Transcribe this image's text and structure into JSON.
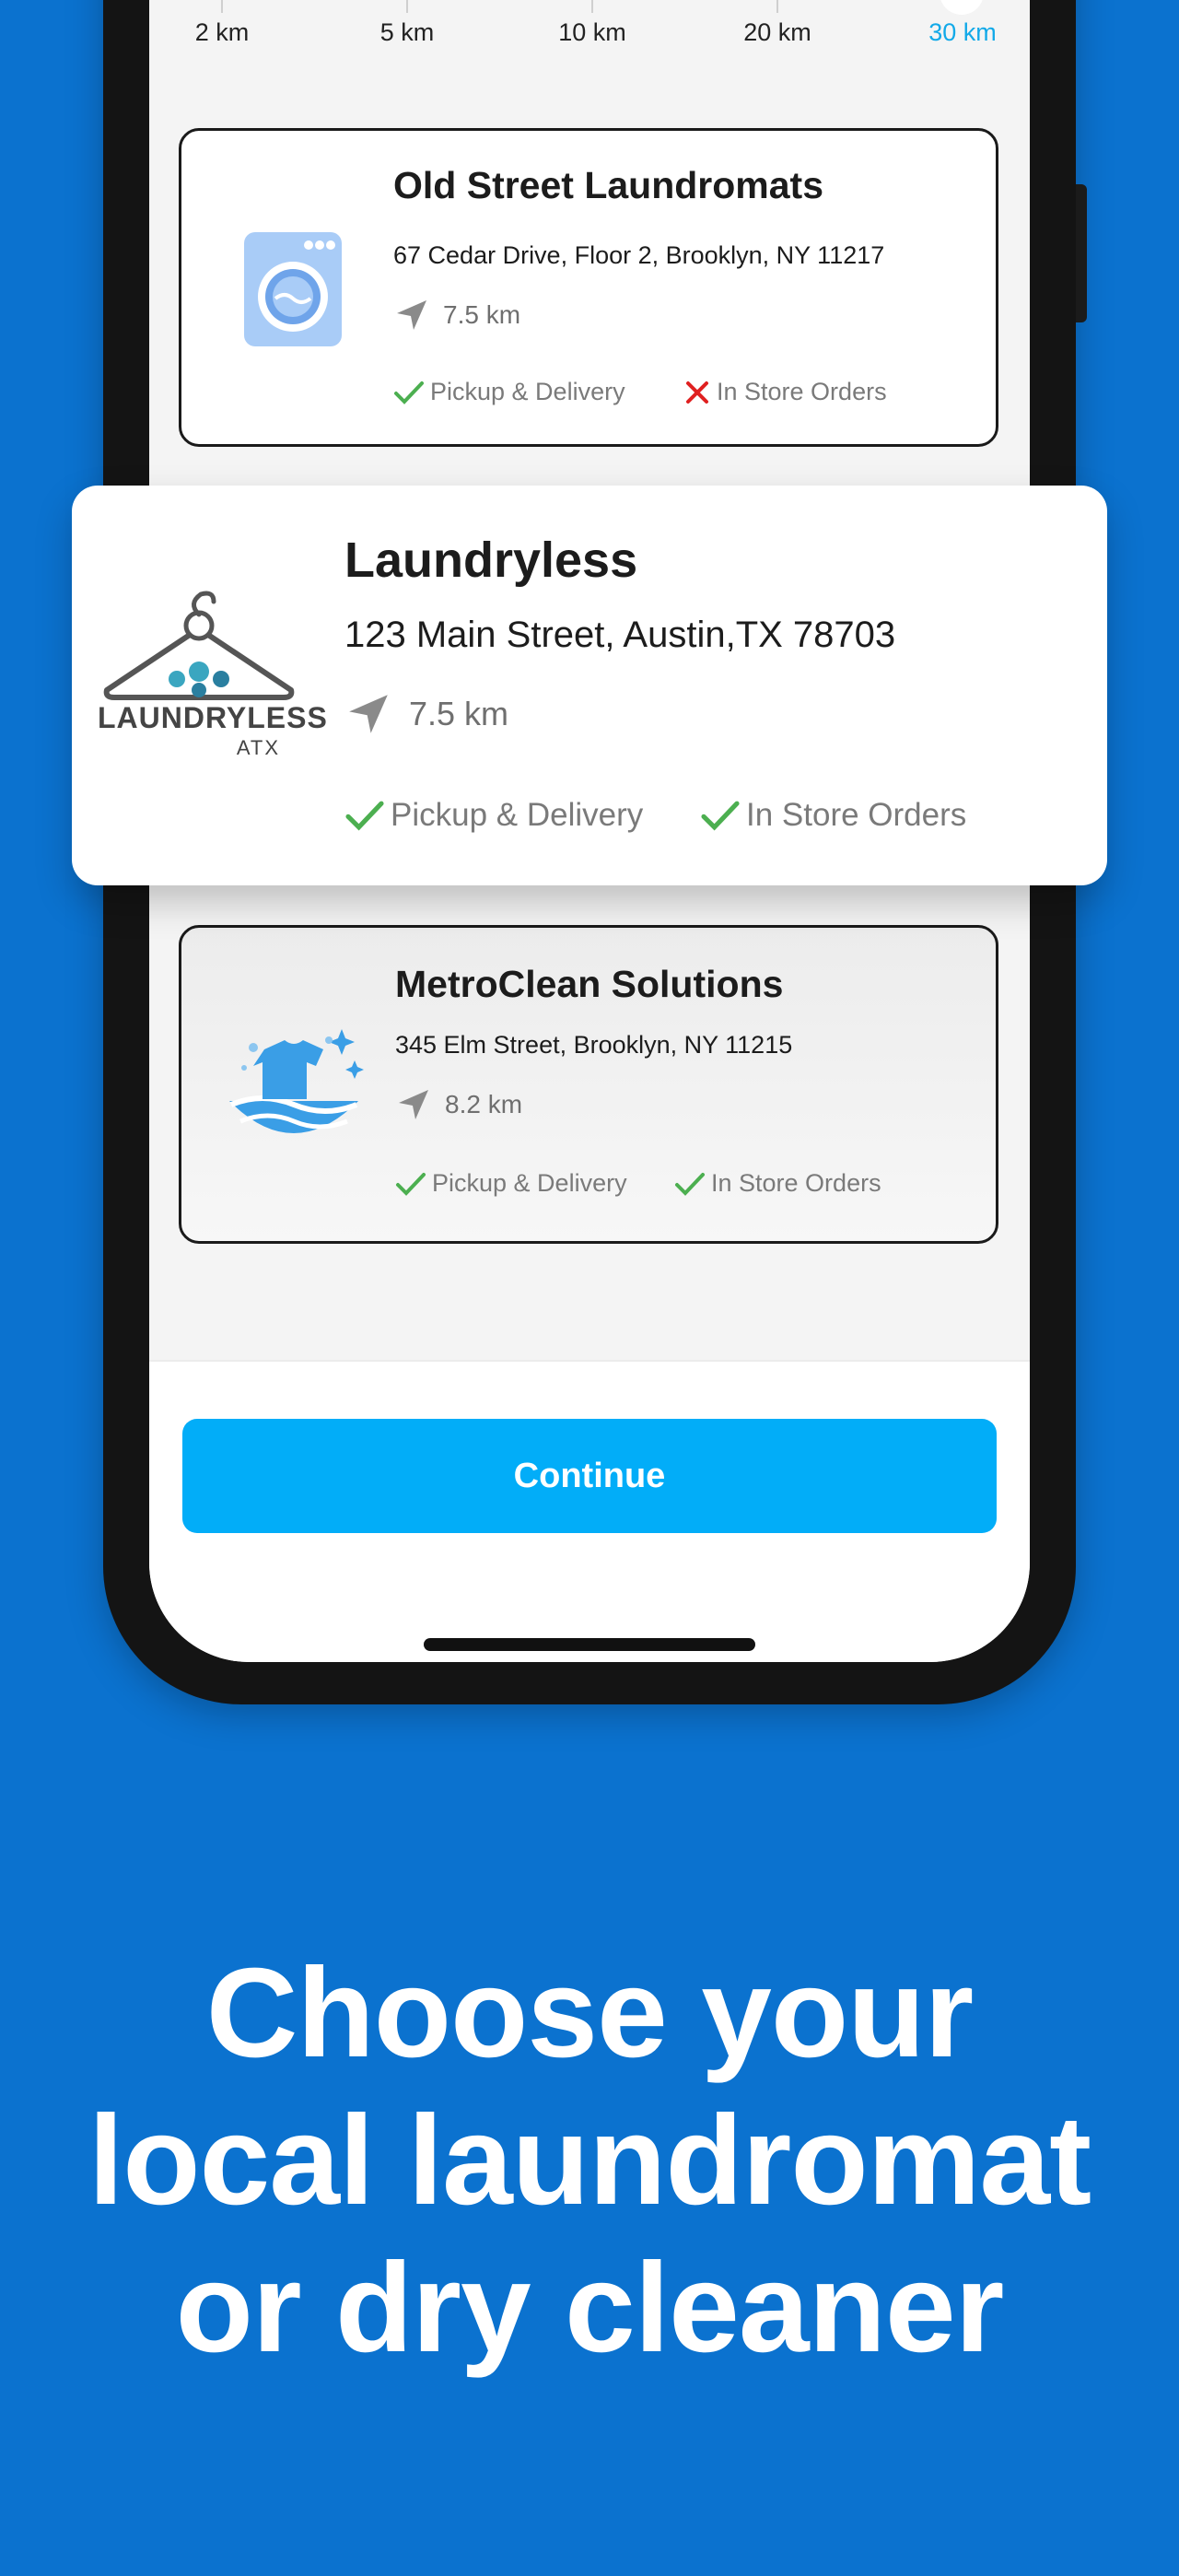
{
  "scale": {
    "labels": [
      "2 km",
      "5 km",
      "10 km",
      "20 km",
      "30 km"
    ],
    "selected": "30 km"
  },
  "cards": [
    {
      "name": "Old Street Laundromats",
      "address": "67 Cedar Drive, Floor 2, Brooklyn, NY 11217",
      "distance": "7.5 km",
      "pickup_label": "Pickup & Delivery",
      "pickup_available": true,
      "instore_label": "In Store Orders",
      "instore_available": false,
      "icon": "washing-machine-icon"
    },
    {
      "name": "Laundryless",
      "address": "123 Main Street, Austin,TX 78703",
      "distance": "7.5 km",
      "pickup_label": "Pickup & Delivery",
      "pickup_available": true,
      "instore_label": "In Store Orders",
      "instore_available": true,
      "logo_text": "LAUNDRYLESS",
      "logo_subtext": "ATX"
    },
    {
      "name": "MetroClean Solutions",
      "address": "345 Elm Street, Brooklyn, NY 11215",
      "distance": "8.2 km",
      "pickup_label": "Pickup & Delivery",
      "pickup_available": true,
      "instore_label": "In Store Orders",
      "instore_available": true,
      "icon": "shirt-water-icon"
    }
  ],
  "continue_label": "Continue",
  "headline": [
    "Choose your",
    "local laundromat",
    "or dry cleaner"
  ],
  "colors": {
    "background": "#0b72cf",
    "accent": "#02adf8",
    "check": "#4caf50",
    "cross": "#e02020"
  }
}
